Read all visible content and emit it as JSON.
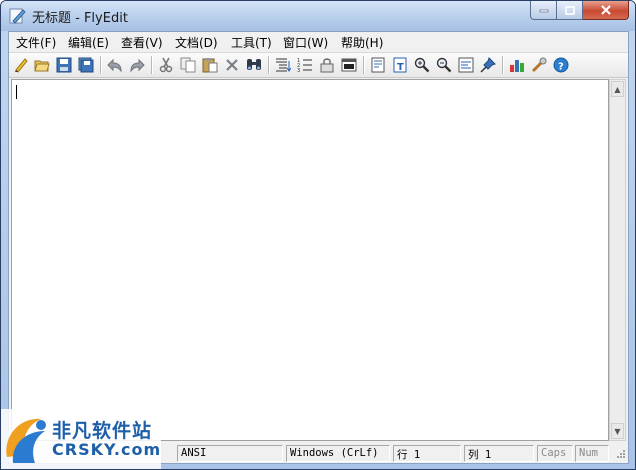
{
  "window": {
    "title": "无标题 - FlyEdit"
  },
  "menu": [
    {
      "label": "文件(F)"
    },
    {
      "label": "编辑(E)"
    },
    {
      "label": "查看(V)"
    },
    {
      "label": "文档(D)"
    },
    {
      "label": "工具(T)"
    },
    {
      "label": "窗口(W)"
    },
    {
      "label": "帮助(H)"
    }
  ],
  "toolbar_icons": [
    "new-icon",
    "open-icon",
    "save-icon",
    "save-all-icon",
    "undo-icon",
    "redo-icon",
    "cut-icon",
    "copy-icon",
    "paste-icon",
    "delete-icon",
    "find-icon",
    "indent-list-icon",
    "numbered-list-icon",
    "lock-icon",
    "console-icon",
    "properties-icon",
    "text-icon",
    "zoom-in-icon",
    "zoom-out-icon",
    "wrap-icon",
    "pin-icon",
    "chart-icon",
    "tools-icon",
    "help-icon"
  ],
  "editor": {
    "content": ""
  },
  "status": {
    "encoding": "ANSI",
    "line_ending": "Windows (CrLf)",
    "line": "行 1",
    "column": "列 1",
    "caps": "Caps",
    "num": "Num"
  },
  "watermark": {
    "line1": "非凡软件站",
    "line2": "CRSKY.com"
  }
}
